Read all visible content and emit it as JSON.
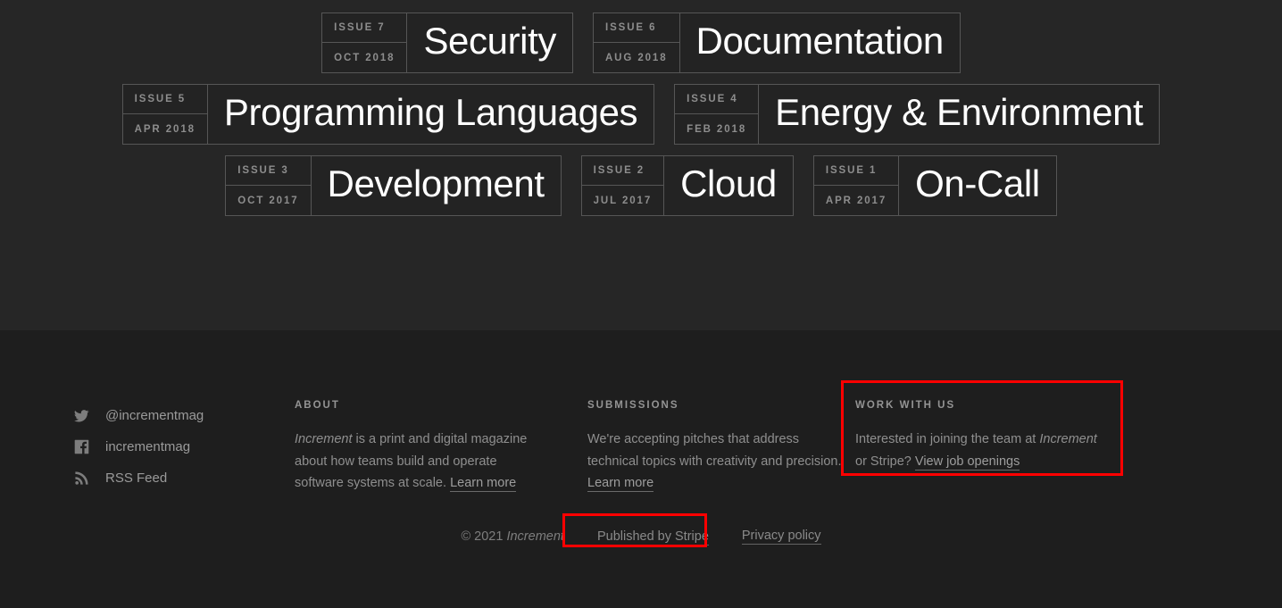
{
  "theme": {
    "bg_top": "#262626",
    "bg_footer": "#1e1e1e",
    "card_border": "#565656",
    "title_color": "#ffffff",
    "meta_color": "#8d8d8d",
    "body_color": "#8f8f8f",
    "highlight_color": "#ff0000"
  },
  "issues": {
    "rows": [
      [
        {
          "issue_label": "ISSUE 7",
          "date_label": "OCT 2018",
          "title": "Security"
        },
        {
          "issue_label": "ISSUE 6",
          "date_label": "AUG 2018",
          "title": "Documentation"
        }
      ],
      [
        {
          "issue_label": "ISSUE 5",
          "date_label": "APR 2018",
          "title": "Programming Languages"
        },
        {
          "issue_label": "ISSUE 4",
          "date_label": "FEB 2018",
          "title": "Energy & Environment"
        }
      ],
      [
        {
          "issue_label": "ISSUE 3",
          "date_label": "OCT 2017",
          "title": "Development"
        },
        {
          "issue_label": "ISSUE 2",
          "date_label": "JUL 2017",
          "title": "Cloud"
        },
        {
          "issue_label": "ISSUE 1",
          "date_label": "APR 2017",
          "title": "On-Call"
        }
      ]
    ]
  },
  "footer": {
    "social": [
      {
        "icon": "twitter-icon",
        "label": "@incrementmag"
      },
      {
        "icon": "facebook-icon",
        "label": "incrementmag"
      },
      {
        "icon": "rss-icon",
        "label": "RSS Feed"
      }
    ],
    "about": {
      "heading": "ABOUT",
      "body_prefix_italic": "Increment",
      "body_text": " is a print and digital magazine about how teams build and operate software systems at scale. ",
      "link_label": "Learn more"
    },
    "submissions": {
      "heading": "SUBMISSIONS",
      "body_text": "We're accepting pitches that address technical topics with creativity and precision. ",
      "link_label": "Learn more"
    },
    "work_with_us": {
      "heading": "WORK WITH US",
      "body_text_1": "Interested in joining the team at ",
      "body_italic": "Increment",
      "body_text_2": " or Stripe? ",
      "link_label": "View job openings"
    },
    "bottom": {
      "copyright_prefix": "© 2021 ",
      "copyright_italic": "Increment",
      "published_label": "Published by Stripe",
      "privacy_label": "Privacy policy"
    }
  }
}
